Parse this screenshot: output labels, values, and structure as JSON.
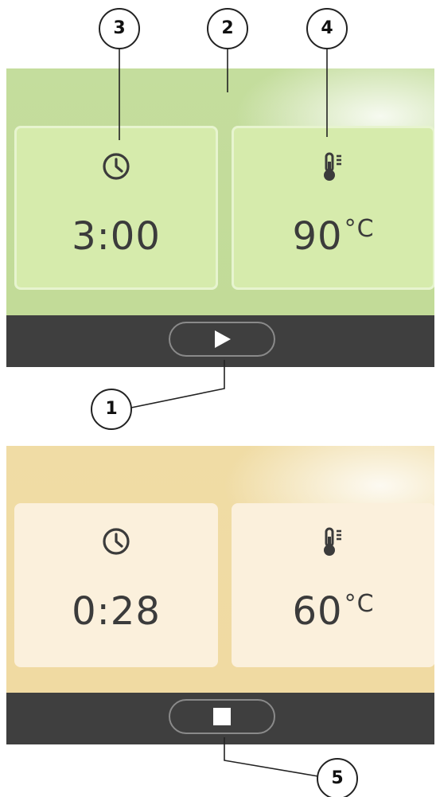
{
  "callouts": {
    "c1": "1",
    "c2": "2",
    "c3": "3",
    "c4": "4",
    "c5": "5"
  },
  "screen_idle": {
    "timer": {
      "value": "3:00",
      "icon": "clock-icon"
    },
    "temperature": {
      "value": "90",
      "unit": "°C",
      "icon": "thermometer-icon"
    },
    "control": {
      "icon": "play-icon"
    },
    "colors": {
      "display": "#c4dd9d",
      "tile": "#d6ebac",
      "bar": "#3f3f3f"
    }
  },
  "screen_running": {
    "timer": {
      "value": "0:28",
      "icon": "clock-icon"
    },
    "temperature": {
      "value": "60",
      "unit": "°C",
      "icon": "thermometer-icon"
    },
    "control": {
      "icon": "stop-icon"
    },
    "colors": {
      "display": "#f0dca5",
      "tile": "#fbf0dc",
      "bar": "#3f3f3f"
    }
  }
}
